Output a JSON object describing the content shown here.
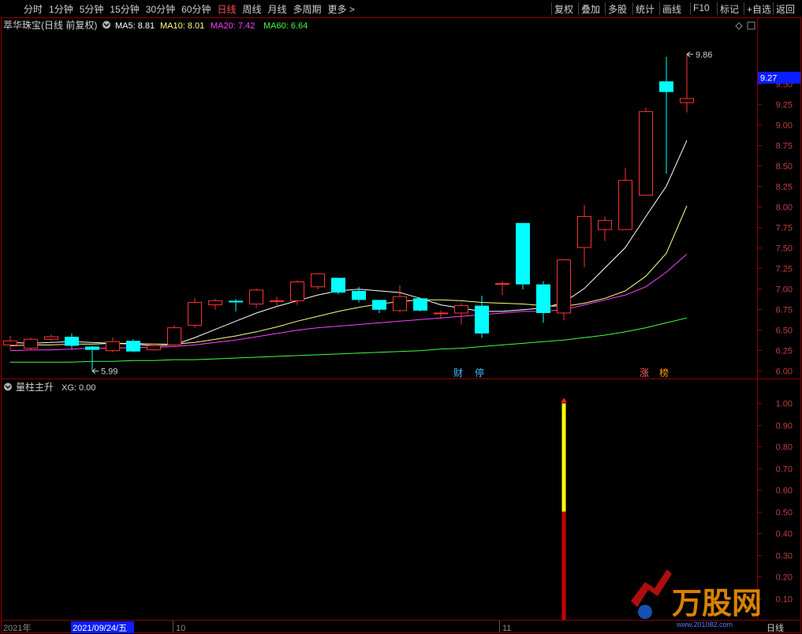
{
  "toolbar": {
    "left": [
      "分时",
      "1分钟",
      "5分钟",
      "15分钟",
      "30分钟",
      "60分钟",
      "日线",
      "周线",
      "月线",
      "多周期",
      "更多 >"
    ],
    "active": "日线",
    "right": [
      "复权",
      "叠加",
      "多股",
      "统计",
      "画线",
      "F10",
      "标记",
      "+自选",
      "返回"
    ]
  },
  "main_panel": {
    "title": "萃华珠宝(日线 前复权)",
    "indicators": [
      {
        "label": "MA5: 8.81",
        "color": "#ffffff"
      },
      {
        "label": "MA10: 8.01",
        "color": "#ffff80"
      },
      {
        "label": "MA20: 7.42",
        "color": "#ff40ff"
      },
      {
        "label": "MA60: 6.64",
        "color": "#40ff40"
      }
    ],
    "current_price_label": "9.27",
    "high_label": "9.86",
    "low_label": "5.99",
    "markers": [
      {
        "text": "财",
        "color": "#40c0ff"
      },
      {
        "text": "停",
        "color": "#40c0ff"
      },
      {
        "text": "涨",
        "color": "#ff6060"
      },
      {
        "text": "榜",
        "color": "#ff9900"
      }
    ]
  },
  "sub_panel": {
    "title": "量柱主升",
    "indicator": "XG: 0.00"
  },
  "date_axis": {
    "labels": [
      "2021年",
      "2021/09/24/五",
      "10",
      "11"
    ],
    "period": "日线"
  },
  "watermark": {
    "brand": "万股网",
    "url": "www.201082.com"
  },
  "chart_data": [
    {
      "type": "candlestick",
      "ylim": [
        5.9,
        10.1
      ],
      "yticks": [
        6.0,
        6.25,
        6.5,
        6.75,
        7.0,
        7.25,
        7.5,
        7.75,
        8.0,
        8.25,
        8.5,
        8.75,
        9.0,
        9.25,
        9.5
      ],
      "candles": [
        {
          "o": 6.31,
          "h": 6.42,
          "l": 6.25,
          "c": 6.36
        },
        {
          "o": 6.27,
          "h": 6.4,
          "l": 6.25,
          "c": 6.38
        },
        {
          "o": 6.38,
          "h": 6.44,
          "l": 6.36,
          "c": 6.41
        },
        {
          "o": 6.41,
          "h": 6.45,
          "l": 6.27,
          "c": 6.3
        },
        {
          "o": 6.29,
          "h": 6.3,
          "l": 5.99,
          "c": 6.25
        },
        {
          "o": 6.24,
          "h": 6.4,
          "l": 6.22,
          "c": 6.35
        },
        {
          "o": 6.36,
          "h": 6.38,
          "l": 6.22,
          "c": 6.23
        },
        {
          "o": 6.25,
          "h": 6.33,
          "l": 6.24,
          "c": 6.3
        },
        {
          "o": 6.31,
          "h": 6.55,
          "l": 6.29,
          "c": 6.52
        },
        {
          "o": 6.55,
          "h": 6.88,
          "l": 6.52,
          "c": 6.83
        },
        {
          "o": 6.8,
          "h": 6.87,
          "l": 6.74,
          "c": 6.85
        },
        {
          "o": 6.85,
          "h": 6.87,
          "l": 6.72,
          "c": 6.83
        },
        {
          "o": 6.81,
          "h": 7.0,
          "l": 6.76,
          "c": 6.98
        },
        {
          "o": 6.84,
          "h": 6.9,
          "l": 6.78,
          "c": 6.85
        },
        {
          "o": 6.85,
          "h": 7.1,
          "l": 6.8,
          "c": 7.08
        },
        {
          "o": 7.02,
          "h": 7.19,
          "l": 6.99,
          "c": 7.18
        },
        {
          "o": 7.13,
          "h": 7.13,
          "l": 6.93,
          "c": 6.95
        },
        {
          "o": 6.97,
          "h": 7.02,
          "l": 6.83,
          "c": 6.86
        },
        {
          "o": 6.86,
          "h": 6.86,
          "l": 6.7,
          "c": 6.74
        },
        {
          "o": 6.73,
          "h": 7.04,
          "l": 6.71,
          "c": 6.9
        },
        {
          "o": 6.88,
          "h": 6.88,
          "l": 6.72,
          "c": 6.73
        },
        {
          "o": 6.7,
          "h": 6.73,
          "l": 6.63,
          "c": 6.7
        },
        {
          "o": 6.7,
          "h": 6.82,
          "l": 6.56,
          "c": 6.79
        },
        {
          "o": 6.79,
          "h": 6.91,
          "l": 6.4,
          "c": 6.45
        },
        {
          "o": 7.06,
          "h": 7.09,
          "l": 6.92,
          "c": 7.06
        },
        {
          "o": 7.8,
          "h": 7.8,
          "l": 6.99,
          "c": 7.05
        },
        {
          "o": 7.05,
          "h": 7.09,
          "l": 6.58,
          "c": 6.7
        },
        {
          "o": 6.7,
          "h": 7.36,
          "l": 6.61,
          "c": 7.35
        },
        {
          "o": 7.5,
          "h": 8.02,
          "l": 7.26,
          "c": 7.88
        },
        {
          "o": 7.72,
          "h": 7.88,
          "l": 7.58,
          "c": 7.83
        },
        {
          "o": 7.72,
          "h": 8.47,
          "l": 7.72,
          "c": 8.32
        },
        {
          "o": 8.14,
          "h": 9.21,
          "l": 8.14,
          "c": 9.16
        },
        {
          "o": 9.53,
          "h": 9.83,
          "l": 8.4,
          "c": 9.4
        },
        {
          "o": 9.27,
          "h": 9.86,
          "l": 9.15,
          "c": 9.32
        }
      ],
      "ma_series": [
        {
          "name": "MA5",
          "color": "#ffffff",
          "values": [
            6.34,
            6.33,
            6.34,
            6.35,
            6.34,
            6.33,
            6.32,
            6.3,
            6.31,
            6.4,
            6.5,
            6.6,
            6.7,
            6.78,
            6.85,
            6.92,
            6.97,
            6.99,
            6.97,
            6.95,
            6.88,
            6.8,
            6.76,
            6.72,
            6.72,
            6.74,
            6.76,
            6.83,
            7.0,
            7.25,
            7.5,
            7.88,
            8.25,
            8.81
          ]
        },
        {
          "name": "MA10",
          "color": "#ffff80",
          "values": [
            6.3,
            6.31,
            6.31,
            6.32,
            6.32,
            6.33,
            6.33,
            6.32,
            6.32,
            6.34,
            6.38,
            6.42,
            6.47,
            6.53,
            6.6,
            6.66,
            6.72,
            6.77,
            6.81,
            6.84,
            6.86,
            6.86,
            6.85,
            6.83,
            6.82,
            6.81,
            6.79,
            6.78,
            6.82,
            6.88,
            6.97,
            7.15,
            7.43,
            8.01
          ]
        },
        {
          "name": "MA20",
          "color": "#ff40ff",
          "values": [
            6.24,
            6.25,
            6.25,
            6.26,
            6.27,
            6.27,
            6.28,
            6.28,
            6.29,
            6.31,
            6.34,
            6.37,
            6.41,
            6.45,
            6.49,
            6.52,
            6.54,
            6.56,
            6.58,
            6.6,
            6.62,
            6.64,
            6.66,
            6.68,
            6.7,
            6.72,
            6.72,
            6.74,
            6.8,
            6.86,
            6.92,
            7.02,
            7.2,
            7.42
          ]
        },
        {
          "name": "MA60",
          "color": "#40ff40",
          "values": [
            6.1,
            6.1,
            6.1,
            6.1,
            6.11,
            6.11,
            6.12,
            6.12,
            6.13,
            6.13,
            6.14,
            6.15,
            6.16,
            6.17,
            6.18,
            6.19,
            6.2,
            6.21,
            6.22,
            6.23,
            6.24,
            6.26,
            6.27,
            6.29,
            6.31,
            6.33,
            6.35,
            6.37,
            6.4,
            6.43,
            6.47,
            6.52,
            6.58,
            6.64
          ]
        }
      ]
    },
    {
      "type": "bar",
      "ylim": [
        0,
        1.1
      ],
      "yticks": [
        0.1,
        0.2,
        0.3,
        0.4,
        0.5,
        0.6,
        0.7,
        0.8,
        0.9,
        1.0
      ],
      "signal_index": 27,
      "segments": [
        {
          "from": 0,
          "to": 0.5,
          "color": "#cc0000"
        },
        {
          "from": 0.5,
          "to": 1.0,
          "color": "#ffff00"
        }
      ]
    }
  ]
}
